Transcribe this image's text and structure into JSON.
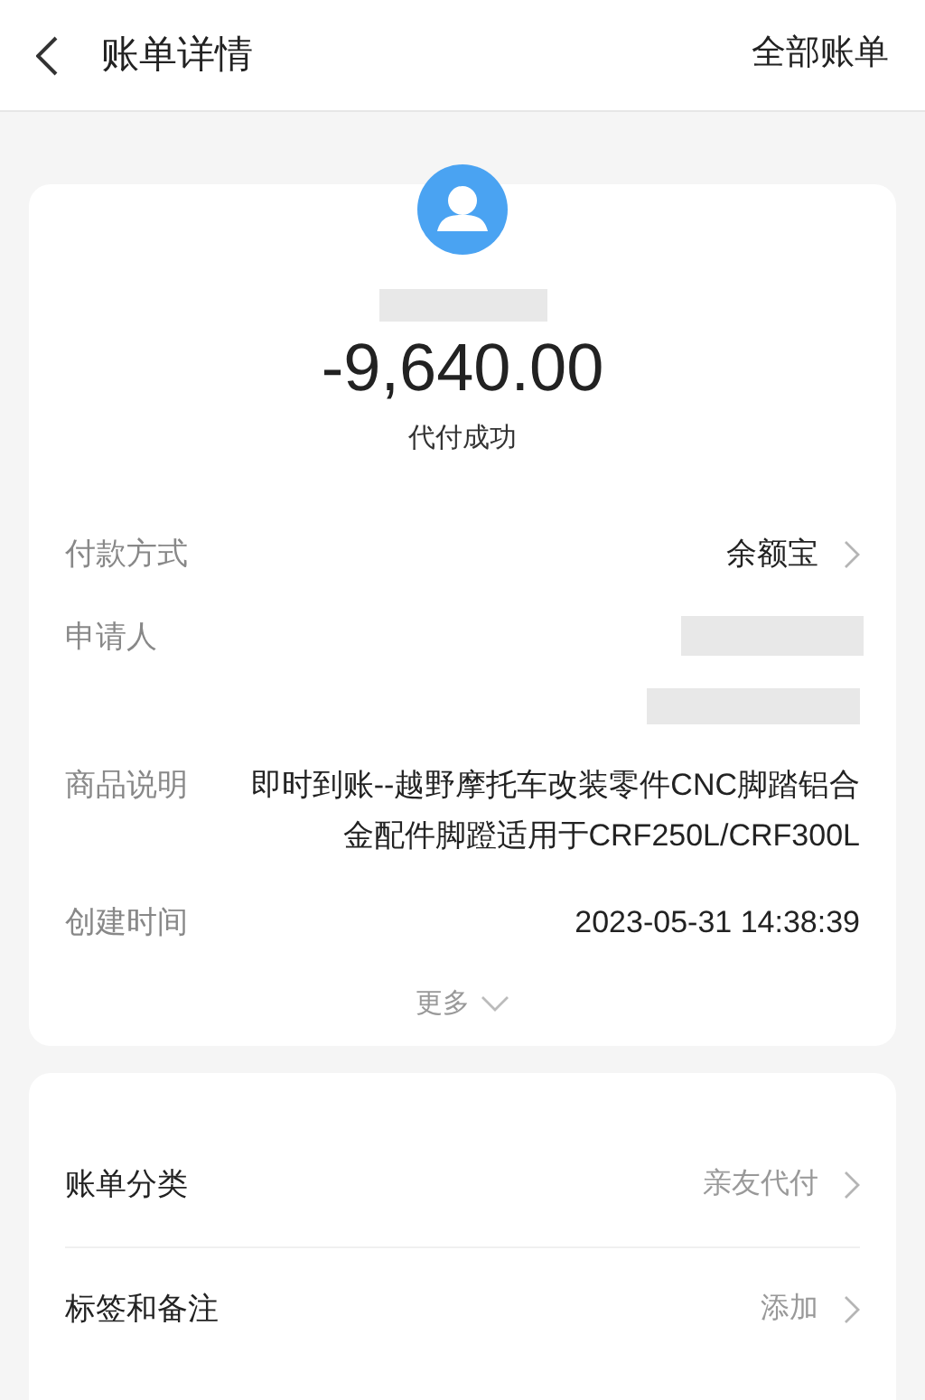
{
  "header": {
    "title": "账单详情",
    "action": "全部账单"
  },
  "summary": {
    "amount": "-9,640.00",
    "status": "代付成功"
  },
  "details": [
    {
      "kind": "link",
      "label": "付款方式",
      "value": "余额宝"
    },
    {
      "kind": "redacted",
      "label": "申请人"
    },
    {
      "kind": "text",
      "label": "商品说明",
      "value": "即时到账--越野摩托车改装零件CNC脚踏铝合金配件脚蹬适用于CRF250L/CRF300L"
    },
    {
      "kind": "text",
      "label": "创建时间",
      "value": "2023-05-31 14:38:39"
    }
  ],
  "more": "更多",
  "settings": [
    {
      "label": "账单分类",
      "value": "亲友代付"
    },
    {
      "label": "标签和备注",
      "value": "添加"
    }
  ]
}
